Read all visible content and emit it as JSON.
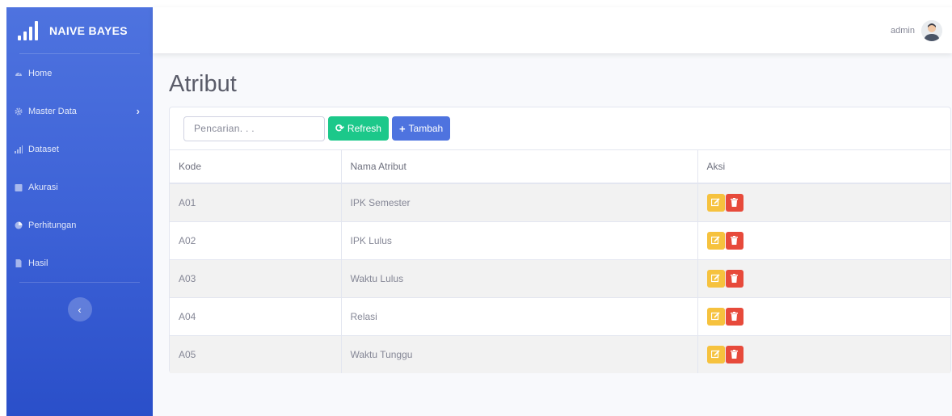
{
  "brand": {
    "title": "NAIVE BAYES",
    "icon": "bar-chart-icon"
  },
  "sidebar": {
    "items": [
      {
        "label": "Home",
        "icon": "tachometer-icon"
      },
      {
        "label": "Master Data",
        "icon": "gear-icon",
        "has_submenu": true
      },
      {
        "label": "Dataset",
        "icon": "bar-chart-icon"
      },
      {
        "label": "Akurasi",
        "icon": "calendar-icon"
      },
      {
        "label": "Perhitungan",
        "icon": "pie-chart-icon"
      },
      {
        "label": "Hasil",
        "icon": "file-icon"
      }
    ],
    "toggle_glyph": "‹"
  },
  "topbar": {
    "user": "admin"
  },
  "page": {
    "title": "Atribut"
  },
  "toolbar": {
    "search_placeholder": "Pencarian. . .",
    "refresh_label": "Refresh",
    "add_label": "Tambah"
  },
  "table": {
    "headers": [
      "Kode",
      "Nama Atribut",
      "Aksi"
    ],
    "rows": [
      {
        "kode": "A01",
        "nama": "IPK Semester"
      },
      {
        "kode": "A02",
        "nama": "IPK Lulus"
      },
      {
        "kode": "A03",
        "nama": "Waktu Lulus"
      },
      {
        "kode": "A04",
        "nama": "Relasi"
      },
      {
        "kode": "A05",
        "nama": "Waktu Tunggu"
      }
    ]
  },
  "colors": {
    "sidebar": "#4e73df",
    "success": "#1cc88a",
    "primary": "#4e73df",
    "warning": "#f6c23e",
    "danger": "#e74a3b"
  }
}
